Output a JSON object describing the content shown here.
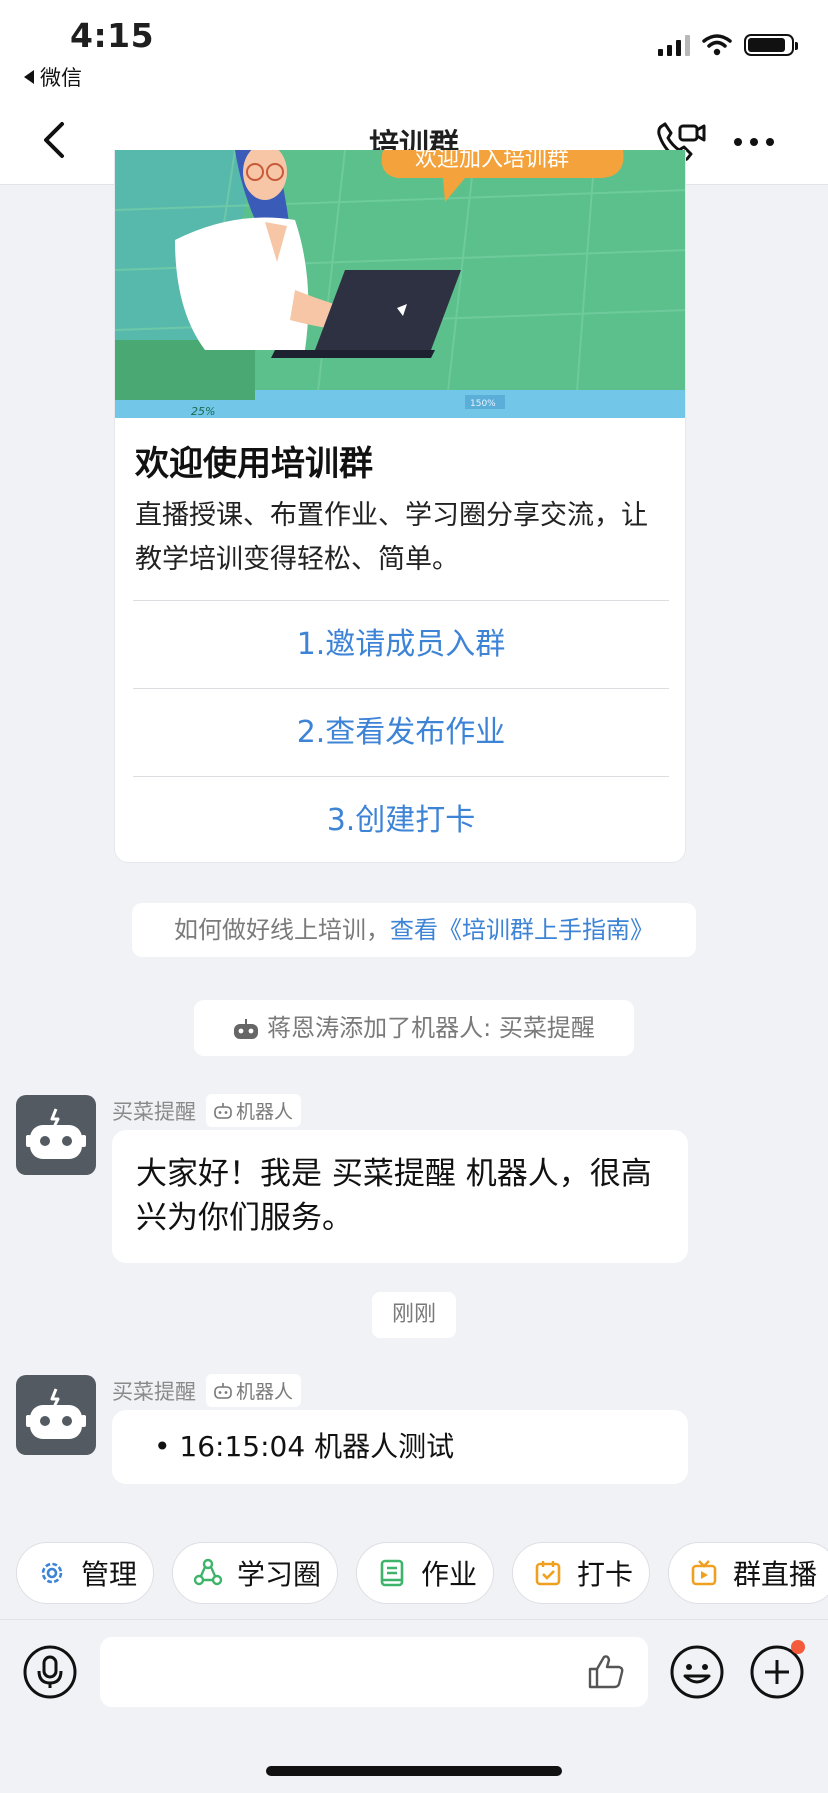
{
  "status_bar": {
    "time": "4:15",
    "back_app": "微信"
  },
  "nav": {
    "title": "培训群"
  },
  "welcome_card": {
    "banner_bubble_text": "欢迎加入培训群",
    "banner_percent_left": "25%",
    "banner_percent_right": "150%",
    "title": "欢迎使用培训群",
    "description": "直播授课、布置作业、学习圈分享交流，让教学培训变得轻松、简单。",
    "links": [
      "1.邀请成员入群",
      "2.查看发布作业",
      "3.创建打卡"
    ]
  },
  "guide_notice": {
    "text": "如何做好线上培训，",
    "link": "查看《培训群上手指南》"
  },
  "robot_notice": {
    "text": "蒋恩涛添加了机器人: 买菜提醒"
  },
  "messages": [
    {
      "sender": "买菜提醒",
      "badge": "机器人",
      "text": "大家好！我是 买菜提醒 机器人，很高兴为你们服务。"
    },
    {
      "sender": "买菜提醒",
      "badge": "机器人",
      "text": "• 16:15:04 机器人测试"
    }
  ],
  "time_separator": "刚刚",
  "quick_actions": [
    {
      "label": "管理",
      "icon": "gear-icon",
      "color": "#3d83d6"
    },
    {
      "label": "学习圈",
      "icon": "circle-share-icon",
      "color": "#3eb46a"
    },
    {
      "label": "作业",
      "icon": "book-icon",
      "color": "#3eb46a"
    },
    {
      "label": "打卡",
      "icon": "calendar-check-icon",
      "color": "#f0a020"
    },
    {
      "label": "群直播",
      "icon": "tv-play-icon",
      "color": "#f0a020"
    }
  ],
  "colors": {
    "link": "#3d83d6",
    "background": "#f1f2f6",
    "avatar": "#545a62",
    "notification_dot": "#f35b3b"
  }
}
